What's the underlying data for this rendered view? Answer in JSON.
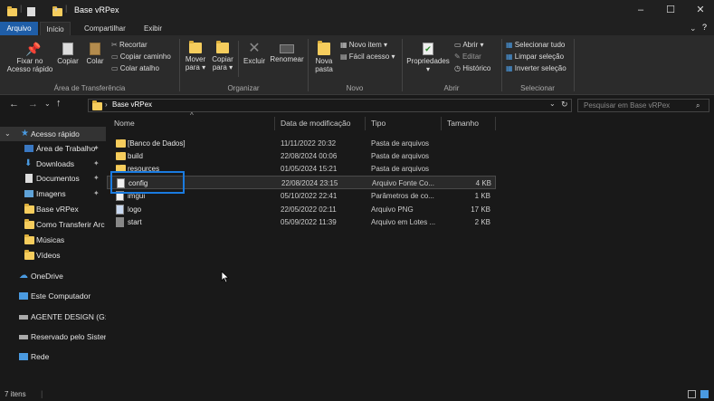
{
  "window": {
    "title": "Base vRPex"
  },
  "tabs": [
    "Arquivo",
    "Início",
    "Compartilhar",
    "Exibir"
  ],
  "ribbon": {
    "groups": {
      "clipboard": "Área de Transferência",
      "organize": "Organizar",
      "new": "Novo",
      "open": "Abrir",
      "select": "Selecionar"
    },
    "pin": "Fixar no",
    "pin2": "Acesso rápido",
    "copy": "Copiar",
    "paste": "Colar",
    "cut": "Recortar",
    "copy_path": "Copiar caminho",
    "paste_shortcut": "Colar atalho",
    "move_to": "Mover",
    "move_to2": "para",
    "copy_to": "Copiar",
    "copy_to2": "para",
    "delete": "Excluir",
    "rename": "Renomear",
    "new_folder": "Nova",
    "new_folder2": "pasta",
    "new_item": "Novo item",
    "easy_access": "Fácil acesso",
    "properties": "Propriedades",
    "open_btn": "Abrir",
    "edit": "Editar",
    "history": "Histórico",
    "select_all": "Selecionar tudo",
    "clear_selection": "Limpar seleção",
    "invert_selection": "Inverter seleção"
  },
  "nav": {
    "address": "Base vRPex",
    "search_placeholder": "Pesquisar em Base vRPex"
  },
  "sidebar": [
    {
      "label": "Acesso rápido"
    },
    {
      "label": "Área de Trabalho"
    },
    {
      "label": "Downloads"
    },
    {
      "label": "Documentos"
    },
    {
      "label": "Imagens"
    },
    {
      "label": "Base vRPex"
    },
    {
      "label": "Como Transferir Arc"
    },
    {
      "label": "Músicas"
    },
    {
      "label": "Vídeos"
    },
    {
      "label": "OneDrive"
    },
    {
      "label": "Este Computador"
    },
    {
      "label": "AGENTE DESIGN (G:)"
    },
    {
      "label": "Reservado pelo Sister"
    },
    {
      "label": "Rede"
    }
  ],
  "columns": [
    "Nome",
    "Data de modificação",
    "Tipo",
    "Tamanho"
  ],
  "files": [
    {
      "name": "[Banco de Dados]",
      "date": "11/11/2022 20:32",
      "type": "Pasta de arquivos",
      "size": ""
    },
    {
      "name": "build",
      "date": "22/08/2024 00:06",
      "type": "Pasta de arquivos",
      "size": ""
    },
    {
      "name": "resources",
      "date": "01/05/2024 15:21",
      "type": "Pasta de arquivos",
      "size": ""
    },
    {
      "name": "config",
      "date": "22/08/2024 23:15",
      "type": "Arquivo Fonte Co...",
      "size": "4 KB"
    },
    {
      "name": "imgui",
      "date": "05/10/2022 22:41",
      "type": "Parâmetros de co...",
      "size": "1 KB"
    },
    {
      "name": "logo",
      "date": "22/05/2022 02:11",
      "type": "Arquivo PNG",
      "size": "17 KB"
    },
    {
      "name": "start",
      "date": "05/09/2022 11:39",
      "type": "Arquivo em Lotes ...",
      "size": "2 KB"
    }
  ],
  "status": {
    "count": "7 itens"
  }
}
